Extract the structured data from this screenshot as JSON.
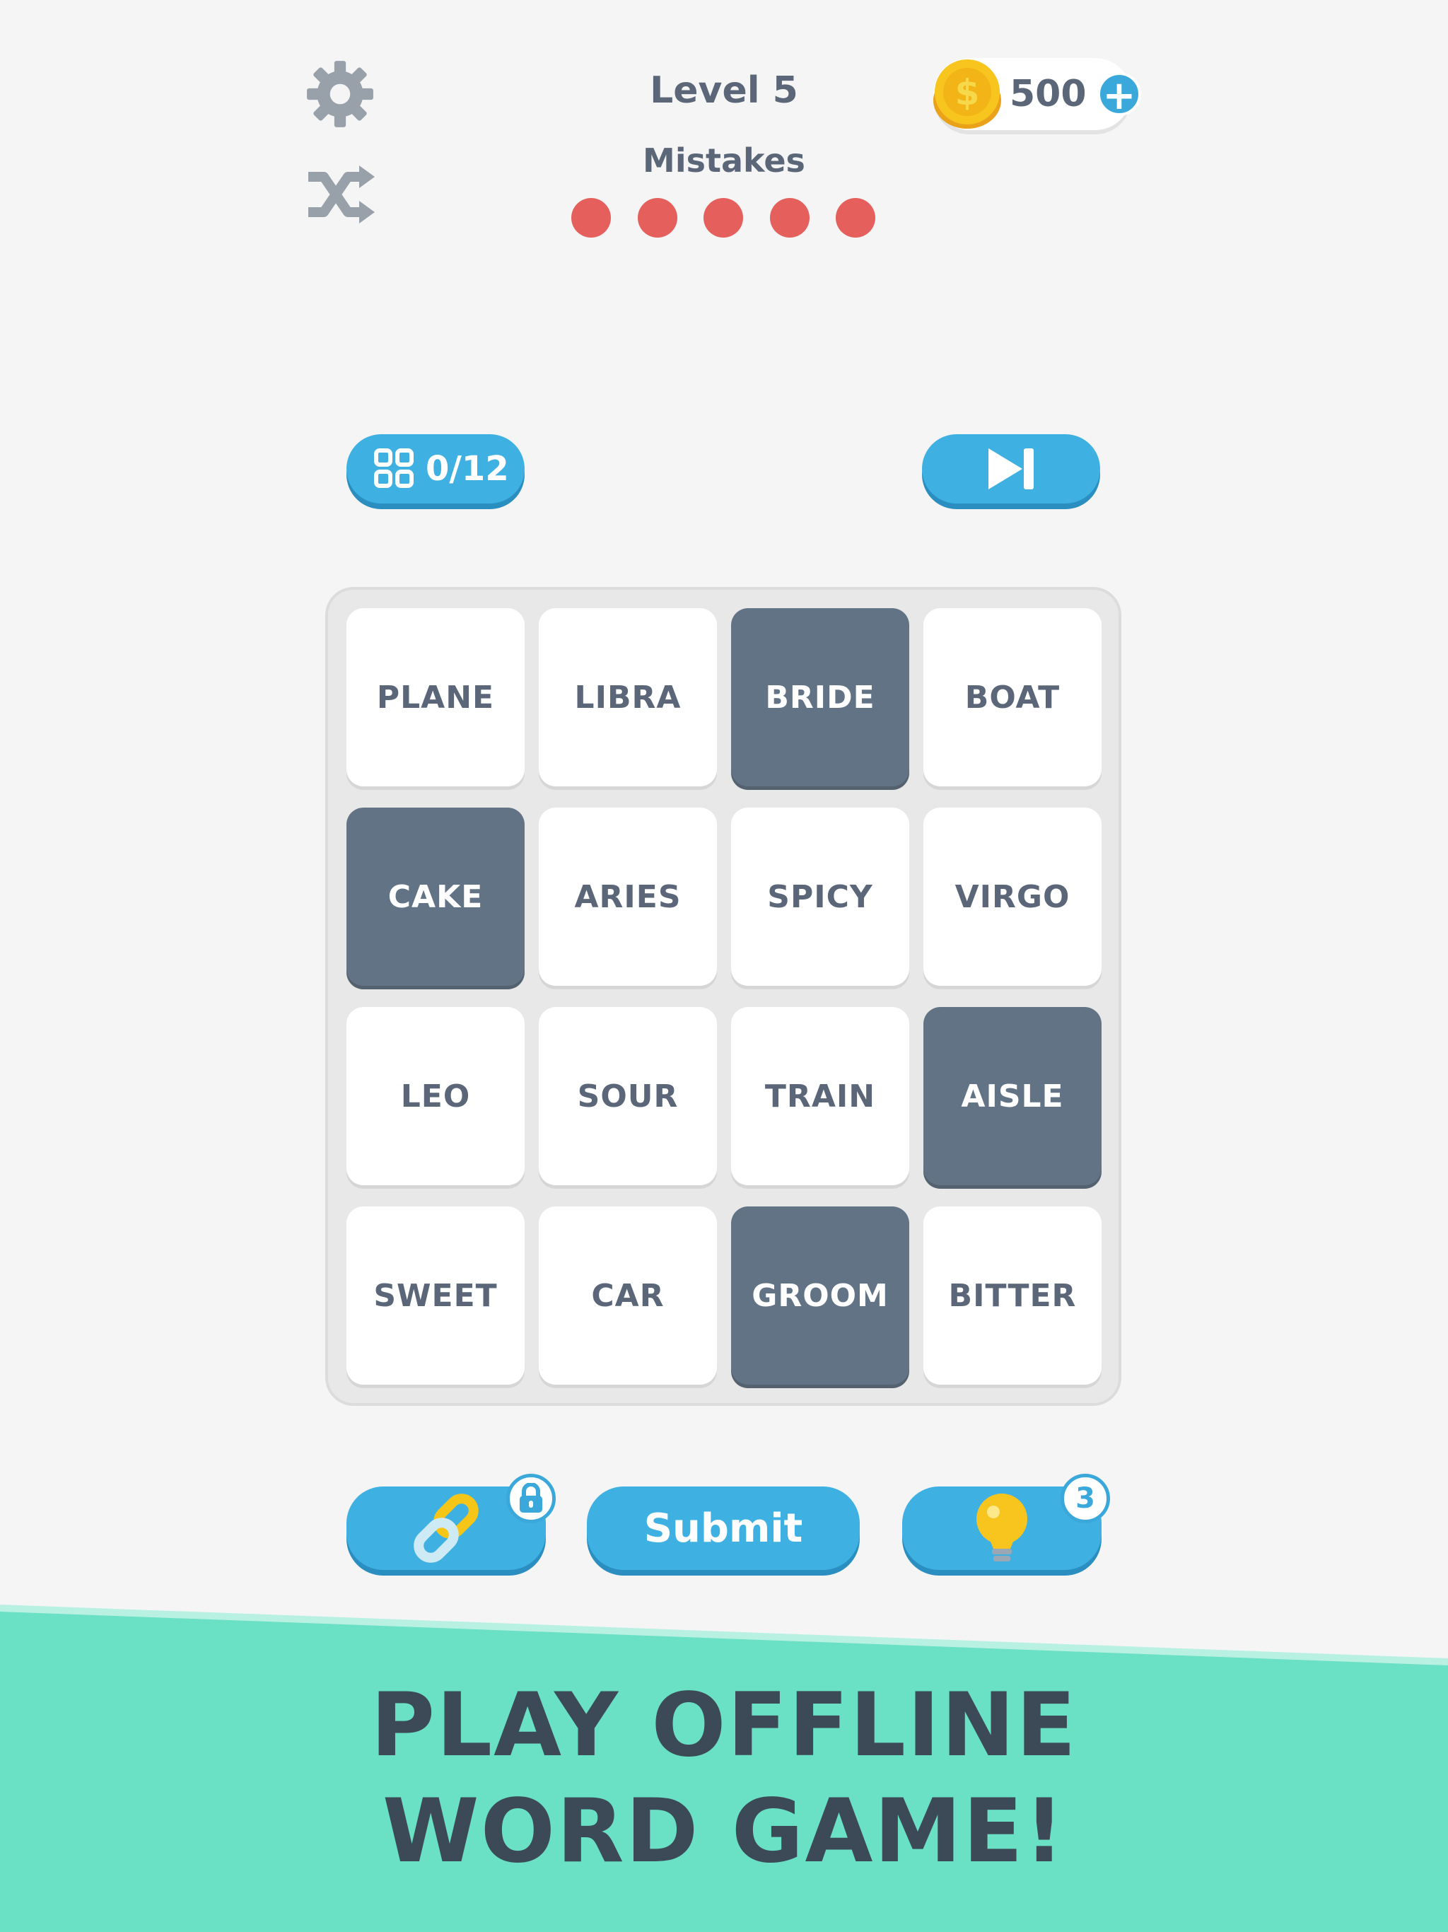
{
  "header": {
    "level_title": "Level 5",
    "mistakes_label": "Mistakes",
    "mistakes_remaining": 5,
    "coins": "500",
    "coin_add_icon": "plus-icon",
    "settings_icon": "gear-icon",
    "shuffle_icon": "shuffle-icon"
  },
  "progress": {
    "text": "0/12",
    "icon": "grid-icon"
  },
  "skip": {
    "icon": "skip-next-icon"
  },
  "board": {
    "tiles": [
      {
        "word": "PLANE",
        "selected": false
      },
      {
        "word": "LIBRA",
        "selected": false
      },
      {
        "word": "BRIDE",
        "selected": true
      },
      {
        "word": "BOAT",
        "selected": false
      },
      {
        "word": "CAKE",
        "selected": true
      },
      {
        "word": "ARIES",
        "selected": false
      },
      {
        "word": "SPICY",
        "selected": false
      },
      {
        "word": "VIRGO",
        "selected": false
      },
      {
        "word": "LEO",
        "selected": false
      },
      {
        "word": "SOUR",
        "selected": false
      },
      {
        "word": "TRAIN",
        "selected": false
      },
      {
        "word": "AISLE",
        "selected": true
      },
      {
        "word": "SWEET",
        "selected": false
      },
      {
        "word": "CAR",
        "selected": false
      },
      {
        "word": "GROOM",
        "selected": true
      },
      {
        "word": "BITTER",
        "selected": false
      }
    ]
  },
  "actions": {
    "link_icon": "chain-link-icon",
    "lock_icon": "lock-icon",
    "submit_label": "Submit",
    "hint_icon": "lightbulb-icon",
    "hint_count": "3"
  },
  "banner": {
    "line1": "PLAY OFFLINE",
    "line2": "WORD GAME!"
  },
  "colors": {
    "background": "#f5f5f5",
    "accent_blue": "#3eb1e2",
    "selected_tile": "#627386",
    "mistake_dot": "#e5605c",
    "banner": "#6ae0c4"
  }
}
